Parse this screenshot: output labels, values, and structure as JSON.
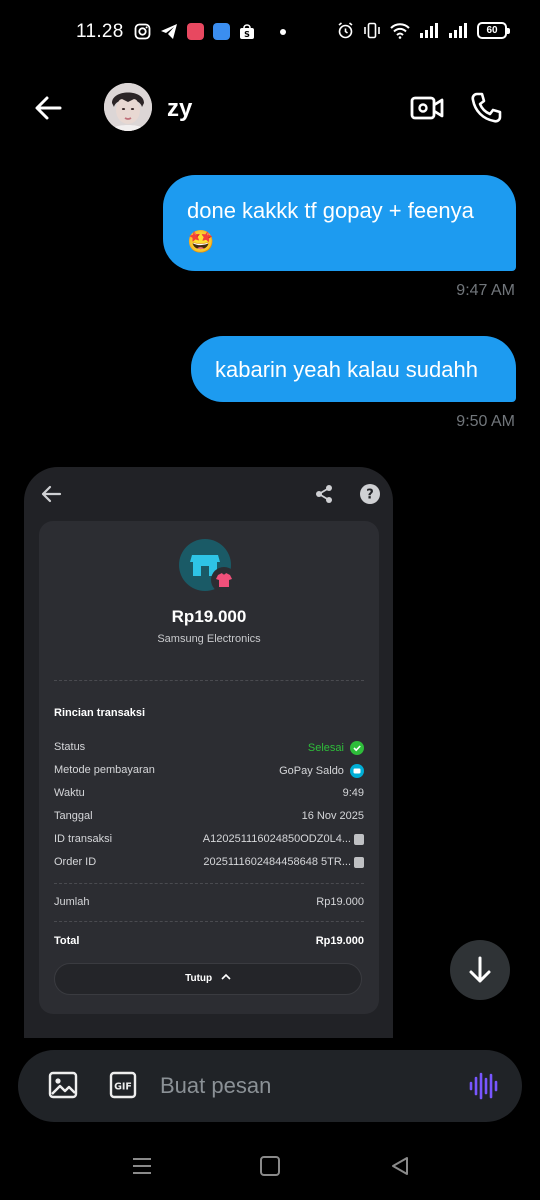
{
  "status_bar": {
    "time": "11.28",
    "battery": "60",
    "left_icons": [
      "instagram-icon",
      "telegram-icon",
      "app-icon",
      "app-icon",
      "shopee-icon"
    ],
    "right_icons": [
      "alarm-icon",
      "vibrate-icon",
      "wifi-icon",
      "signal-icon",
      "signal-icon",
      "battery-icon"
    ]
  },
  "header": {
    "contact_name": "zy"
  },
  "messages": [
    {
      "text": "done kakkk tf gopay + feenya 🤩",
      "time": "9:47 AM"
    },
    {
      "text": "kabarin yeah kalau sudahh",
      "time": "9:50 AM"
    }
  ],
  "receipt": {
    "amount": "Rp19.000",
    "merchant": "Samsung Electronics",
    "section_title": "Rincian transaksi",
    "rows": [
      {
        "label": "Status",
        "value": "Selesai"
      },
      {
        "label": "Metode pembayaran",
        "value": "GoPay Saldo"
      },
      {
        "label": "Waktu",
        "value": "9:49"
      },
      {
        "label": "Tanggal",
        "value": "16 Nov 2025"
      },
      {
        "label": "ID transaksi",
        "value": "A120251116024850ODZ0L4..."
      },
      {
        "label": "Order ID",
        "value": "2025111602484458648 5TR..."
      }
    ],
    "jumlah_label": "Jumlah",
    "jumlah_value": "Rp19.000",
    "total_label": "Total",
    "total_value": "Rp19.000",
    "close_label": "Tutup"
  },
  "composer": {
    "placeholder": "Buat pesan"
  },
  "colors": {
    "bubble": "#1d9bf0",
    "background": "#000000",
    "accent_voice": "#7856ff",
    "status_ok": "#2ebd3a"
  }
}
